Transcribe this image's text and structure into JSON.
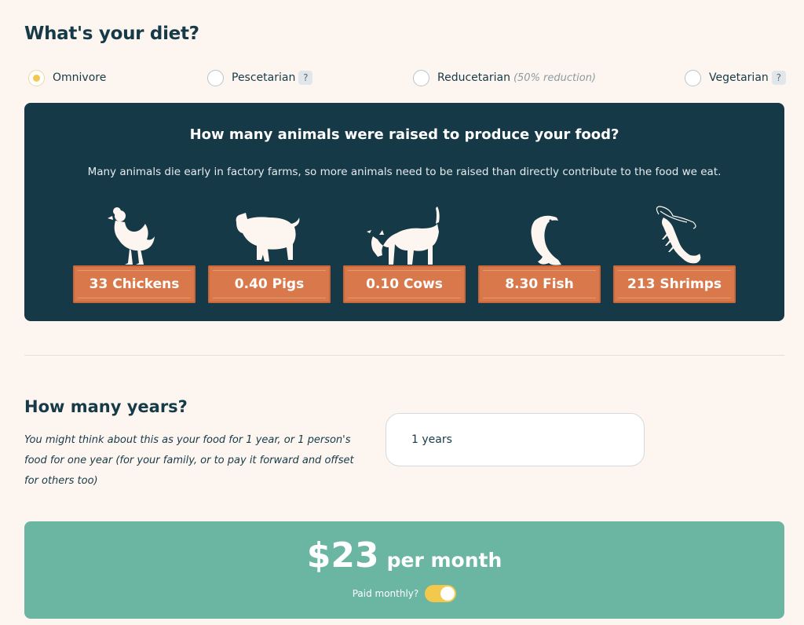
{
  "diet": {
    "title": "What's your diet?",
    "options": [
      {
        "label": "Omnivore",
        "note": "",
        "help": "",
        "selected": true
      },
      {
        "label": "Pescetarian",
        "note": "",
        "help": "?",
        "selected": false
      },
      {
        "label": "Reducetarian",
        "note": "(50% reduction)",
        "help": "",
        "selected": false
      },
      {
        "label": "Vegetarian",
        "note": "",
        "help": "?",
        "selected": false
      }
    ]
  },
  "animals_panel": {
    "title": "How many animals were raised to produce your food?",
    "subtitle": "Many animals die early in factory farms, so more animals need to be raised than directly contribute to the food we eat.",
    "items": [
      {
        "icon": "chicken-icon",
        "label": "33 Chickens"
      },
      {
        "icon": "pig-icon",
        "label": "0.40 Pigs"
      },
      {
        "icon": "cow-icon",
        "label": "0.10 Cows"
      },
      {
        "icon": "fish-icon",
        "label": "8.30 Fish"
      },
      {
        "icon": "shrimp-icon",
        "label": "213 Shrimps"
      }
    ]
  },
  "years": {
    "title": "How many years?",
    "description": "You might think about this as your food for 1 year, or 1 person's food for one year (for your family, or to pay it forward and offset for others too)",
    "value": "1 years"
  },
  "price": {
    "amount": "$23",
    "period": "per month",
    "paid_monthly_label": "Paid monthly?",
    "paid_monthly": true
  },
  "colors": {
    "background": "#fdf6f0",
    "panel": "#163947",
    "plank": "#d9784a",
    "price_panel": "#6bb5a3",
    "accent_yellow": "#f2c94c"
  }
}
